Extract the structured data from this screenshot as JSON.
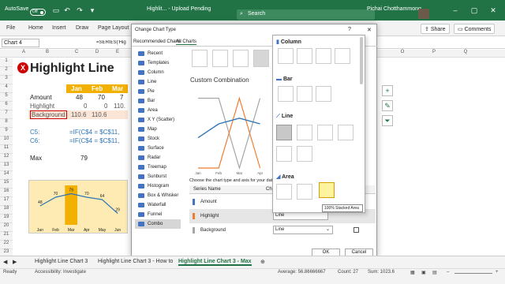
{
  "titlebar": {
    "autosave": "AutoSave",
    "toggle": "Off",
    "title": "Highlit... - Upload Pending",
    "search_placeholder": "Search",
    "user": "Pichai Chotthammong"
  },
  "ribbon": {
    "tabs": [
      "File",
      "Home",
      "Insert",
      "Draw",
      "Page Layout"
    ],
    "share": "Share",
    "comments": "Comments"
  },
  "formulabar": {
    "namebox": "Chart 4",
    "formula": "=SERIES('Hig"
  },
  "columns": [
    "A",
    "B",
    "C",
    "D",
    "E",
    "O",
    "P",
    "Q"
  ],
  "rows": [
    "1",
    "2",
    "3",
    "4",
    "5",
    "6",
    "7",
    "8",
    "9",
    "10",
    "11",
    "12",
    "13",
    "14",
    "15",
    "16",
    "17",
    "18",
    "19",
    "20",
    "21",
    "22",
    "23"
  ],
  "sheet": {
    "title": "Highlight Line",
    "months": [
      "Jan",
      "Feb",
      "Mar"
    ],
    "labels": {
      "amount": "Amount",
      "highlight": "Highlight",
      "background": "Background"
    },
    "amount": [
      "48",
      "70",
      "7"
    ],
    "highlight": [
      "0",
      "0",
      "110."
    ],
    "background": [
      "110.6",
      "110.6"
    ],
    "c5": "C5:",
    "c6": "C6:",
    "f5": "=IF(C$4 = $C$11,",
    "f6": "=IF(C$4 = $C$11,",
    "max_label": "Max",
    "max_value": "79"
  },
  "mini_chart": {
    "categories": [
      "Jan",
      "Feb",
      "Mar",
      "Apr",
      "May",
      "Jun"
    ],
    "values": [
      48,
      70,
      79,
      70,
      64,
      29
    ],
    "highlight_index": 2
  },
  "dialog": {
    "title": "Change Chart Type",
    "help": "?",
    "close": "✕",
    "tabs": [
      "Recommended Charts",
      "All Charts"
    ],
    "chart_types": [
      "Recent",
      "Templates",
      "Column",
      "Line",
      "Pie",
      "Bar",
      "Area",
      "X Y (Scatter)",
      "Map",
      "Stock",
      "Surface",
      "Radar",
      "Treemap",
      "Sunburst",
      "Histogram",
      "Box & Whisker",
      "Waterfall",
      "Funnel",
      "Combo"
    ],
    "selected_type": "Combo",
    "preview_title": "Custom Combination",
    "preview_xlabels": [
      "Jan",
      "Feb",
      "Mar",
      "Apr"
    ],
    "instruction": "Choose the chart type and axis for your data s",
    "series_header": "Series Name",
    "chart_type_header": "Ch",
    "series": [
      {
        "name": "Amount",
        "color": "#4472c4",
        "type": ""
      },
      {
        "name": "Highlight",
        "color": "#ed7d31",
        "type": "Line"
      },
      {
        "name": "Background",
        "color": "#a5a5a5",
        "type": "Line"
      }
    ],
    "ok": "OK",
    "cancel": "Cancel"
  },
  "dropdown_panel": {
    "sections": [
      "Column",
      "Bar",
      "Line",
      "Area"
    ],
    "tooltip": "100% Stacked Area"
  },
  "sheettabs": [
    "Highlight Line Chart 3",
    "Highlight Line Chart 3 - How to",
    "Highlight Line Chart 3 - Max"
  ],
  "statusbar": {
    "ready": "Ready",
    "accessibility": "Accessibility: Investigate",
    "average": "Average: 56.86666667",
    "count": "Count: 27",
    "sum": "Sum: 1023.6"
  }
}
